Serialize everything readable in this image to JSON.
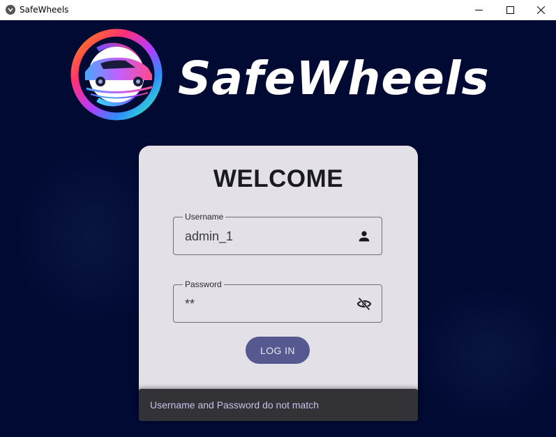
{
  "window": {
    "title": "SafeWheels",
    "controls": [
      "minimize-icon",
      "maximize-icon",
      "close-icon"
    ]
  },
  "brand": {
    "name": "SafeWheels",
    "logo": "car-ring-logo"
  },
  "login_card": {
    "heading": "WELCOME",
    "username": {
      "label": "Username",
      "value": "admin_1",
      "icon": "person-icon"
    },
    "password": {
      "label": "Password",
      "value": "**",
      "icon": "eye-off-icon"
    },
    "login_button": "LOG IN"
  },
  "snackbar": {
    "message": "Username and Password do not match"
  },
  "colors": {
    "background": "#010a33",
    "card": "#e3e0e8",
    "button": "#55598f",
    "snackbar": "#333236",
    "snackbar_text": "#c9c2e8"
  }
}
